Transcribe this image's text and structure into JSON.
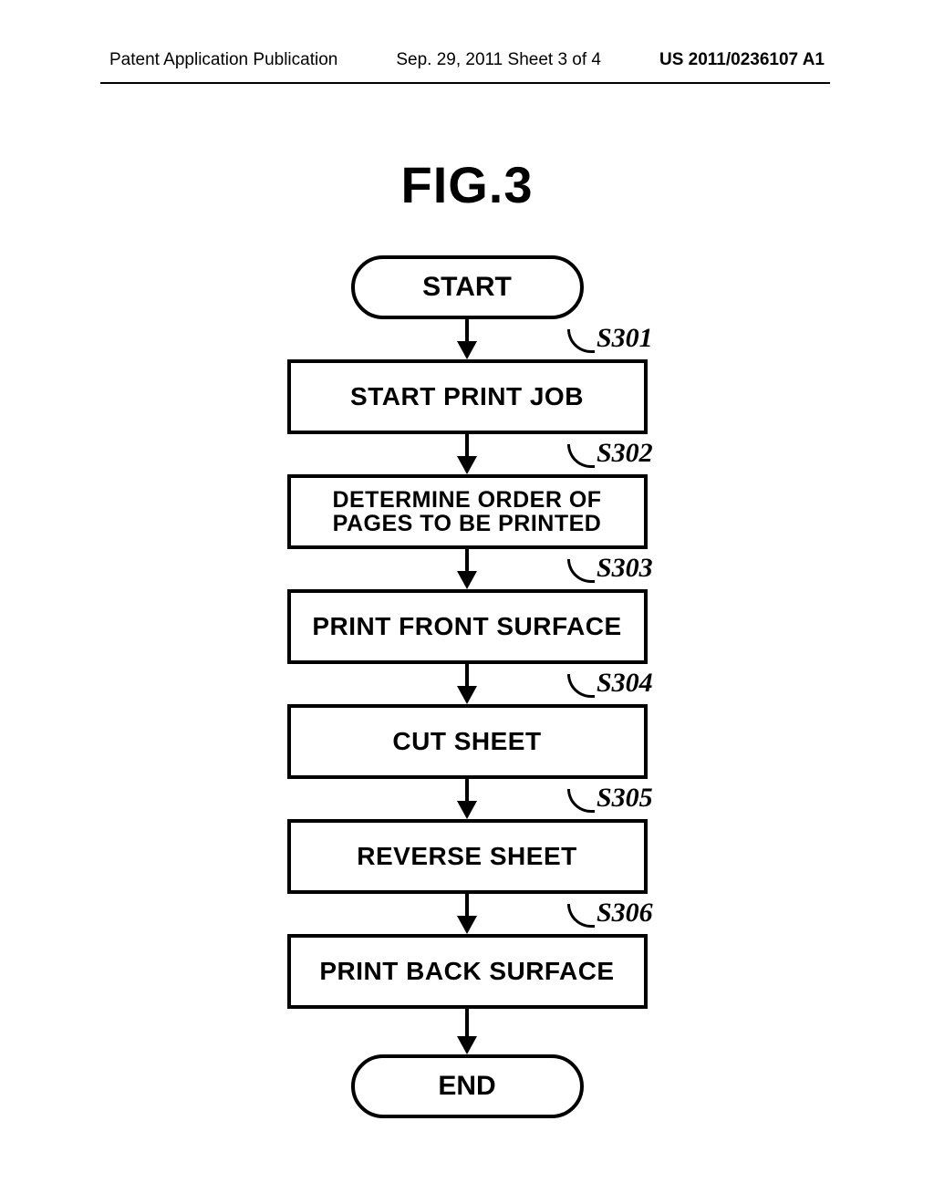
{
  "header": {
    "left": "Patent Application Publication",
    "center": "Sep. 29, 2011  Sheet 3 of 4",
    "right": "US 2011/0236107 A1"
  },
  "figure_title": "FIG.3",
  "flow": {
    "start": "START",
    "end": "END",
    "steps": [
      {
        "id": "S301",
        "label": "START PRINT JOB"
      },
      {
        "id": "S302",
        "label": "DETERMINE ORDER OF PAGES TO BE PRINTED"
      },
      {
        "id": "S303",
        "label": "PRINT FRONT SURFACE"
      },
      {
        "id": "S304",
        "label": "CUT SHEET"
      },
      {
        "id": "S305",
        "label": "REVERSE SHEET"
      },
      {
        "id": "S306",
        "label": "PRINT BACK SURFACE"
      }
    ]
  }
}
